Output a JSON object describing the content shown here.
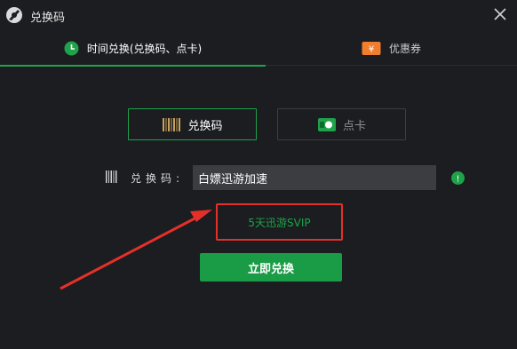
{
  "window": {
    "title": "兑换码",
    "logo_icon": "app-logo-icon",
    "close_icon": "close-icon"
  },
  "tabs": [
    {
      "label": "时间兑换(兑换码、点卡)",
      "icon": "clock-icon",
      "active": true
    },
    {
      "label": "优惠券",
      "icon": "coupon-icon",
      "active": false
    }
  ],
  "modes": [
    {
      "label": "兑换码",
      "icon": "barcode-icon",
      "active": true
    },
    {
      "label": "点卡",
      "icon": "point-card-icon",
      "active": false
    }
  ],
  "form": {
    "label": "兑换码:",
    "value": "白嫖迅游加速",
    "field_icon": "barcode-icon",
    "status_icon": "check-icon"
  },
  "result": {
    "text": "5天迅游SVIP"
  },
  "actions": {
    "redeem_label": "立即兑换"
  },
  "colors": {
    "background": "#1b1d20",
    "accent": "#1fa24a",
    "highlight": "#e5302a",
    "input_bg": "#3b3d41",
    "coupon": "#f07e2e"
  }
}
